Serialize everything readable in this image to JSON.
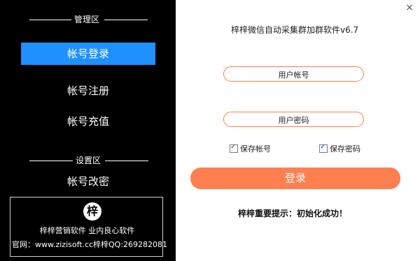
{
  "sidebar": {
    "manage_header": "管理区",
    "settings_header": "设置区",
    "nav": {
      "login": "帐号登录",
      "register": "帐号注册",
      "recharge": "帐号充值",
      "change": "帐号改密"
    },
    "promo": {
      "logo_char": "梓",
      "slogan": "梓梓营销软件 业内良心软件",
      "website": "官网：www.zizisoft.cc",
      "qq": "梓梓QQ:269282081"
    }
  },
  "main": {
    "close_icon": "×",
    "title": "梓梓微信自动采集群加群软件v6.7",
    "account_placeholder": "用户帐号",
    "password_placeholder": "用户密码",
    "save_account_label": "保存帐号",
    "save_password_label": "保存密码",
    "save_account_checked": true,
    "save_password_checked": true,
    "login_label": "登录",
    "status_text": "梓梓重要提示：初始化成功！"
  },
  "colors": {
    "sidebar_bg": "#000000",
    "active_nav": "#1e90ff",
    "accent": "#ff7f50"
  }
}
